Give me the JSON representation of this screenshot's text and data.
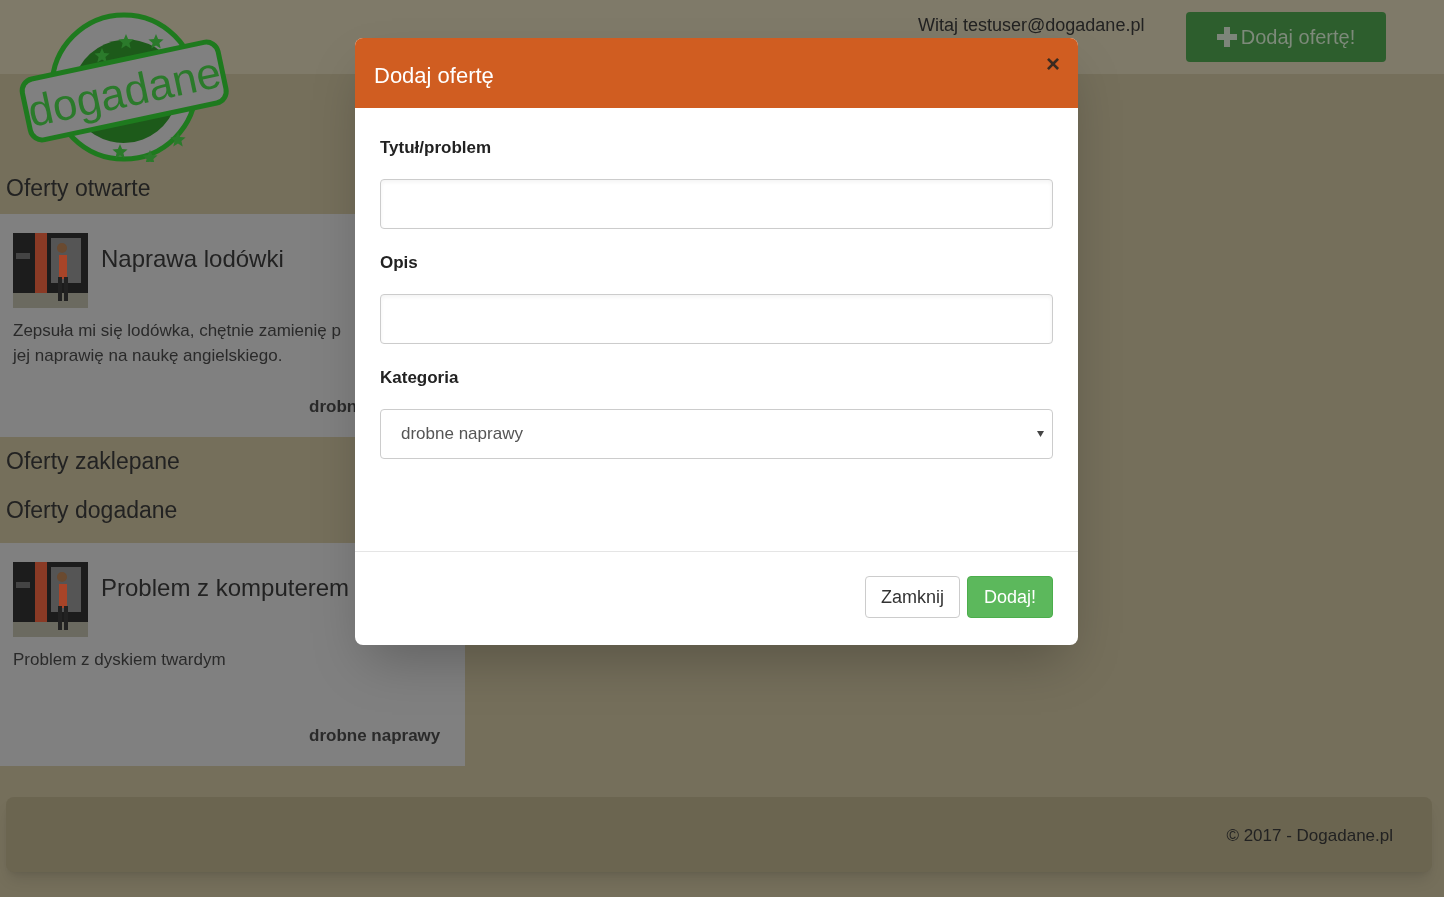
{
  "header": {
    "logo_text": "dogadane",
    "greeting": "Witaj testuser@dogadane.pl",
    "add_button": "Dodaj ofertę!"
  },
  "sections": [
    {
      "title": "Oferty otwarte",
      "offers": [
        {
          "kind": "picture",
          "title": "Naprawa lodówki",
          "description": "Zepsuła mi się lodówka, chętnie zamienię p\njej naprawię na naukę angielskiego.",
          "category": "drobn"
        }
      ]
    },
    {
      "title": "Oferty zaklepane"
    },
    {
      "title": "Oferty dogadane",
      "offers": [
        {
          "kind": "picture",
          "title": "Problem z komputerem",
          "description": "Problem z dyskiem twardym",
          "category": "drobne naprawy"
        }
      ]
    }
  ],
  "footer": {
    "text": "© 2017 - Dogadane.pl"
  },
  "modal": {
    "title": "Dodaj ofertę",
    "close_symbol": "×",
    "fields": [
      {
        "kind": "input",
        "label": "Tytuł/problem"
      },
      {
        "kind": "input",
        "label": "Opis"
      },
      {
        "kind": "select",
        "label": "Kategoria",
        "value": "drobne naprawy"
      }
    ],
    "buttons": [
      {
        "kind": "default",
        "label": "Zamknij"
      },
      {
        "kind": "primary",
        "label": "Dodaj!"
      }
    ]
  }
}
